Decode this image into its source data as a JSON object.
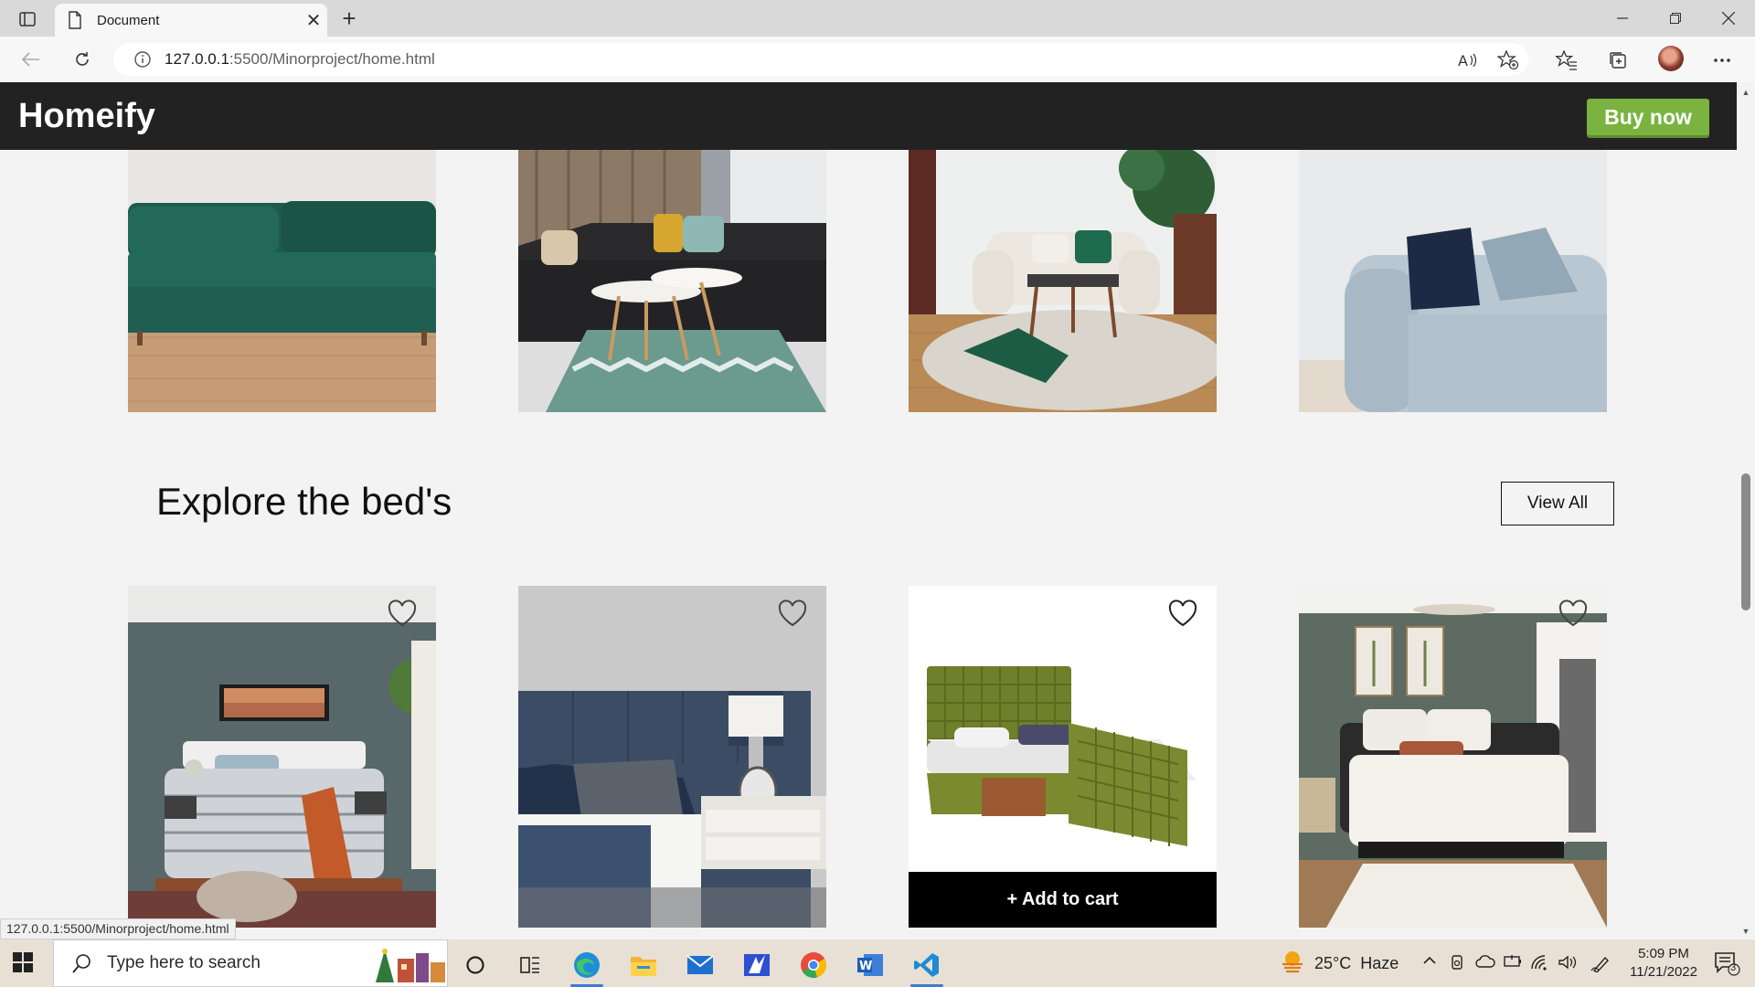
{
  "browser": {
    "tab_title": "Document",
    "url_host": "127.0.0.1",
    "url_rest": ":5500/Minorproject/home.html",
    "status_url": "127.0.0.1:5500/Minorproject/home.html"
  },
  "site": {
    "brand": "Homeify",
    "buy_label": "Buy now",
    "section_title": "Explore the bed's",
    "view_all_label": "View All",
    "add_to_cart_label": "+ Add to cart",
    "colors": {
      "header": "#222222",
      "accent": "#7ab340",
      "page_bg": "#f3f3f3"
    }
  },
  "taskbar": {
    "search_placeholder": "Type here to search",
    "weather": "25°C",
    "weather_desc": "Haze",
    "time": "5:09 PM",
    "date": "11/21/2022",
    "notifications": "3"
  }
}
